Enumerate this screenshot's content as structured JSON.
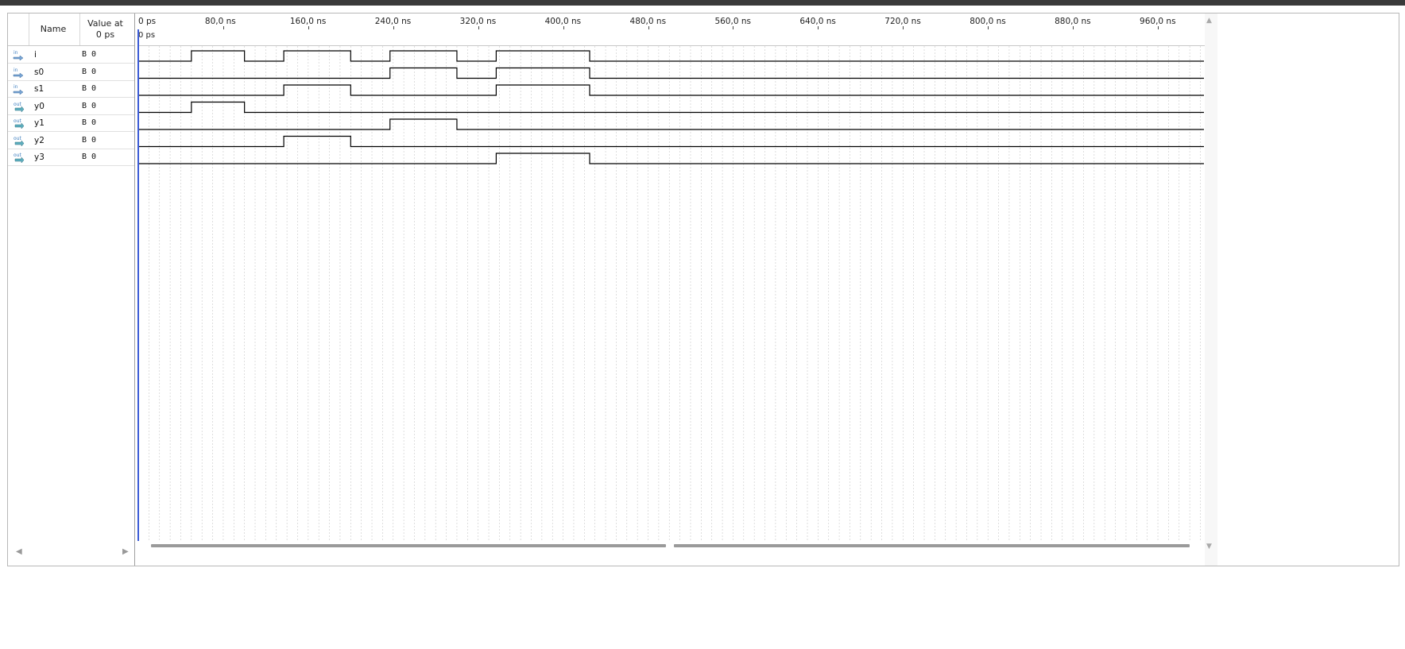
{
  "columns": {
    "name": "Name",
    "value_line1": "Value at",
    "value_line2": "0 ps"
  },
  "signals": [
    {
      "dir": "in",
      "name": "i",
      "value": "B 0",
      "toggles": [
        50,
        100,
        137,
        200,
        237,
        300,
        337,
        425
      ]
    },
    {
      "dir": "in",
      "name": "s0",
      "value": "B 0",
      "toggles": [
        237,
        300,
        337,
        425
      ]
    },
    {
      "dir": "in",
      "name": "s1",
      "value": "B 0",
      "toggles": [
        137,
        200,
        337,
        425
      ]
    },
    {
      "dir": "out",
      "name": "y0",
      "value": "B 0",
      "toggles": [
        50,
        100
      ]
    },
    {
      "dir": "out",
      "name": "y1",
      "value": "B 0",
      "toggles": [
        237,
        300
      ]
    },
    {
      "dir": "out",
      "name": "y2",
      "value": "B 0",
      "toggles": [
        137,
        200
      ]
    },
    {
      "dir": "out",
      "name": "y3",
      "value": "B 0",
      "toggles": [
        337,
        425
      ]
    }
  ],
  "timeline": {
    "unit": "ns",
    "start_label": "0 ps",
    "cursor_label": "0 ps",
    "ticks": [
      "80,0 ns",
      "160,0 ns",
      "240,0 ns",
      "320,0 ns",
      "400,0 ns",
      "480,0 ns",
      "560,0 ns",
      "640,0 ns",
      "720,0 ns",
      "800,0 ns",
      "880,0 ns",
      "960,0 ns"
    ],
    "tick_values": [
      80,
      160,
      240,
      320,
      400,
      480,
      560,
      640,
      720,
      800,
      880,
      960
    ],
    "end": 1000,
    "grid_step": 10
  },
  "colors": {
    "cursor": "#3b5bd6",
    "wave": "#000000",
    "grid": "#c8c8c8"
  },
  "icons": {
    "in": "input-pin-icon",
    "out": "output-pin-icon"
  }
}
